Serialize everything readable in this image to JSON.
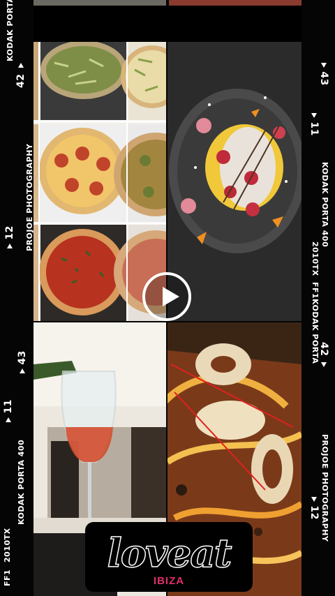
{
  "left_strip": {
    "top_label": "KODAK PORTA",
    "frame_top": "42",
    "photography": "PROJOE PHOTOGRAPHY",
    "frame_12": "12",
    "frame_43": "43",
    "frame_11": "11",
    "kodak_400": "KODAK PORTA 400",
    "code": "2010TX",
    "ff1": "FF1"
  },
  "right_strip": {
    "frame_43": "43",
    "frame_11": "11",
    "kodak_400": "KODAK PORTA 400",
    "code": "2010TX",
    "ff1": "FF1",
    "kodak": "KODAK PORTA",
    "frame_42": "42",
    "frame_12": "12",
    "photography": "PROJOE PHOTOGRAPHY"
  },
  "logo": {
    "name": "loveat",
    "sub": "IBIZA"
  },
  "video": {
    "play_icon": "play-icon"
  }
}
